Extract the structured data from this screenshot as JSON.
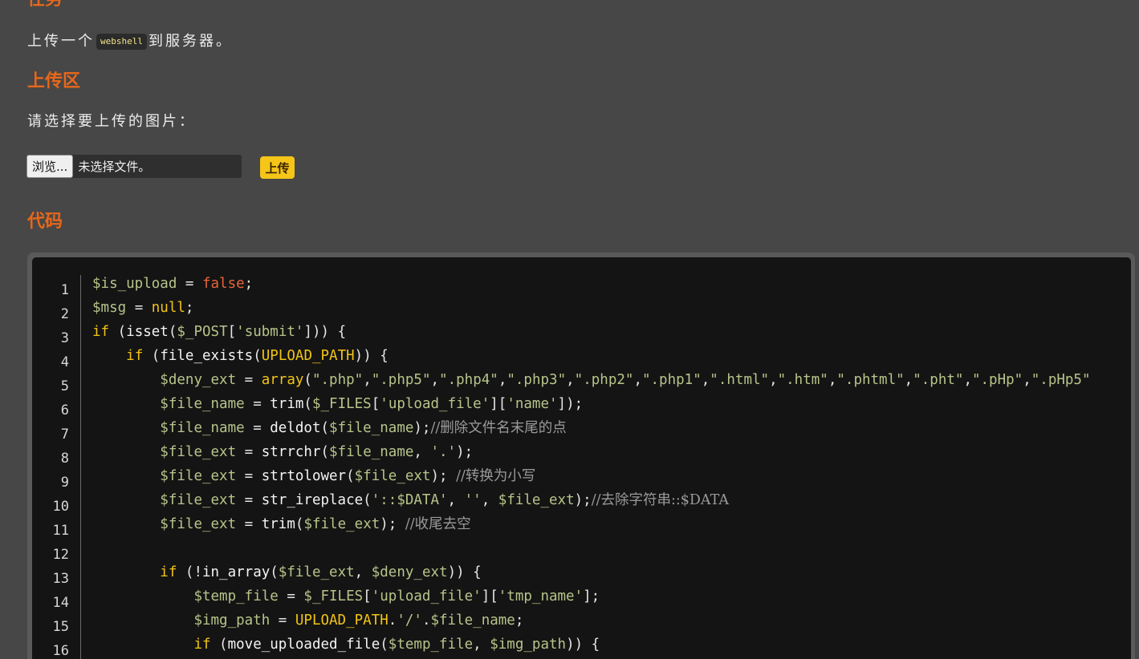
{
  "headings": {
    "task": "任务",
    "upload": "上传区",
    "code": "代码"
  },
  "task": {
    "before": "上传一个",
    "code": "webshell",
    "after": "到服务器。"
  },
  "upload": {
    "prompt": "请选择要上传的图片：",
    "browse_label": "浏览...",
    "no_file_label": "未选择文件。",
    "submit_label": "上传"
  },
  "code": {
    "line_numbers": [
      "1",
      "2",
      "3",
      "4",
      "5",
      "6",
      "7",
      "8",
      "9",
      "10",
      "11",
      "12",
      "13",
      "14",
      "15",
      "16"
    ],
    "lines": [
      [
        [
          "v",
          "$is_upload"
        ],
        [
          "p",
          " = "
        ],
        [
          "lit",
          "false"
        ],
        [
          "p",
          ";"
        ]
      ],
      [
        [
          "v",
          "$msg"
        ],
        [
          "p",
          " = "
        ],
        [
          "kw",
          "null"
        ],
        [
          "p",
          ";"
        ]
      ],
      [
        [
          "kw",
          "if"
        ],
        [
          "p",
          " ("
        ],
        [
          "fn",
          "isset"
        ],
        [
          "p",
          "("
        ],
        [
          "v",
          "$_POST"
        ],
        [
          "p",
          "["
        ],
        [
          "s",
          "'submit'"
        ],
        [
          "p",
          "])) {"
        ]
      ],
      [
        [
          "p",
          "    "
        ],
        [
          "kw",
          "if"
        ],
        [
          "p",
          " ("
        ],
        [
          "fn",
          "file_exists"
        ],
        [
          "p",
          "("
        ],
        [
          "cst",
          "UPLOAD_PATH"
        ],
        [
          "p",
          ")) {"
        ]
      ],
      [
        [
          "p",
          "        "
        ],
        [
          "v",
          "$deny_ext"
        ],
        [
          "p",
          " = "
        ],
        [
          "kw",
          "array"
        ],
        [
          "p",
          "("
        ],
        [
          "s",
          "\".php\""
        ],
        [
          "p",
          ","
        ],
        [
          "s",
          "\".php5\""
        ],
        [
          "p",
          ","
        ],
        [
          "s",
          "\".php4\""
        ],
        [
          "p",
          ","
        ],
        [
          "s",
          "\".php3\""
        ],
        [
          "p",
          ","
        ],
        [
          "s",
          "\".php2\""
        ],
        [
          "p",
          ","
        ],
        [
          "s",
          "\".php1\""
        ],
        [
          "p",
          ","
        ],
        [
          "s",
          "\".html\""
        ],
        [
          "p",
          ","
        ],
        [
          "s",
          "\".htm\""
        ],
        [
          "p",
          ","
        ],
        [
          "s",
          "\".phtml\""
        ],
        [
          "p",
          ","
        ],
        [
          "s",
          "\".pht\""
        ],
        [
          "p",
          ","
        ],
        [
          "s",
          "\".pHp\""
        ],
        [
          "p",
          ","
        ],
        [
          "s",
          "\".pHp5\""
        ]
      ],
      [
        [
          "p",
          "        "
        ],
        [
          "v",
          "$file_name"
        ],
        [
          "p",
          " = "
        ],
        [
          "fn",
          "trim"
        ],
        [
          "p",
          "("
        ],
        [
          "v",
          "$_FILES"
        ],
        [
          "p",
          "["
        ],
        [
          "s",
          "'upload_file'"
        ],
        [
          "p",
          "]["
        ],
        [
          "s",
          "'name'"
        ],
        [
          "p",
          "]);"
        ]
      ],
      [
        [
          "p",
          "        "
        ],
        [
          "v",
          "$file_name"
        ],
        [
          "p",
          " = "
        ],
        [
          "fn",
          "deldot"
        ],
        [
          "p",
          "("
        ],
        [
          "v",
          "$file_name"
        ],
        [
          "p",
          ");"
        ],
        [
          "cm",
          "//删除文件名末尾的点"
        ]
      ],
      [
        [
          "p",
          "        "
        ],
        [
          "v",
          "$file_ext"
        ],
        [
          "p",
          " = "
        ],
        [
          "fn",
          "strrchr"
        ],
        [
          "p",
          "("
        ],
        [
          "v",
          "$file_name"
        ],
        [
          "p",
          ", "
        ],
        [
          "s",
          "'.'"
        ],
        [
          "p",
          ");"
        ]
      ],
      [
        [
          "p",
          "        "
        ],
        [
          "v",
          "$file_ext"
        ],
        [
          "p",
          " = "
        ],
        [
          "fn",
          "strtolower"
        ],
        [
          "p",
          "("
        ],
        [
          "v",
          "$file_ext"
        ],
        [
          "p",
          "); "
        ],
        [
          "cm",
          "//转换为小写"
        ]
      ],
      [
        [
          "p",
          "        "
        ],
        [
          "v",
          "$file_ext"
        ],
        [
          "p",
          " = "
        ],
        [
          "fn",
          "str_ireplace"
        ],
        [
          "p",
          "("
        ],
        [
          "s",
          "'::$DATA'"
        ],
        [
          "p",
          ", "
        ],
        [
          "s",
          "''"
        ],
        [
          "p",
          ", "
        ],
        [
          "v",
          "$file_ext"
        ],
        [
          "p",
          ");"
        ],
        [
          "cm",
          "//去除字符串::$DATA"
        ]
      ],
      [
        [
          "p",
          "        "
        ],
        [
          "v",
          "$file_ext"
        ],
        [
          "p",
          " = "
        ],
        [
          "fn",
          "trim"
        ],
        [
          "p",
          "("
        ],
        [
          "v",
          "$file_ext"
        ],
        [
          "p",
          "); "
        ],
        [
          "cm",
          "//收尾去空"
        ]
      ],
      [
        [
          "p",
          ""
        ]
      ],
      [
        [
          "p",
          "        "
        ],
        [
          "kw",
          "if"
        ],
        [
          "p",
          " (!"
        ],
        [
          "fn",
          "in_array"
        ],
        [
          "p",
          "("
        ],
        [
          "v",
          "$file_ext"
        ],
        [
          "p",
          ", "
        ],
        [
          "v",
          "$deny_ext"
        ],
        [
          "p",
          ")) {"
        ]
      ],
      [
        [
          "p",
          "            "
        ],
        [
          "v",
          "$temp_file"
        ],
        [
          "p",
          " = "
        ],
        [
          "v",
          "$_FILES"
        ],
        [
          "p",
          "["
        ],
        [
          "s",
          "'upload_file'"
        ],
        [
          "p",
          "]["
        ],
        [
          "s",
          "'tmp_name'"
        ],
        [
          "p",
          "];"
        ]
      ],
      [
        [
          "p",
          "            "
        ],
        [
          "v",
          "$img_path"
        ],
        [
          "p",
          " = "
        ],
        [
          "cst",
          "UPLOAD_PATH"
        ],
        [
          "p",
          "."
        ],
        [
          "s",
          "'/'"
        ],
        [
          "p",
          "."
        ],
        [
          "v",
          "$file_name"
        ],
        [
          "p",
          ";"
        ]
      ],
      [
        [
          "p",
          "            "
        ],
        [
          "kw",
          "if"
        ],
        [
          "p",
          " ("
        ],
        [
          "fn",
          "move_uploaded_file"
        ],
        [
          "p",
          "("
        ],
        [
          "v",
          "$temp_file"
        ],
        [
          "p",
          ", "
        ],
        [
          "v",
          "$img_path"
        ],
        [
          "p",
          ")) {"
        ]
      ]
    ]
  }
}
